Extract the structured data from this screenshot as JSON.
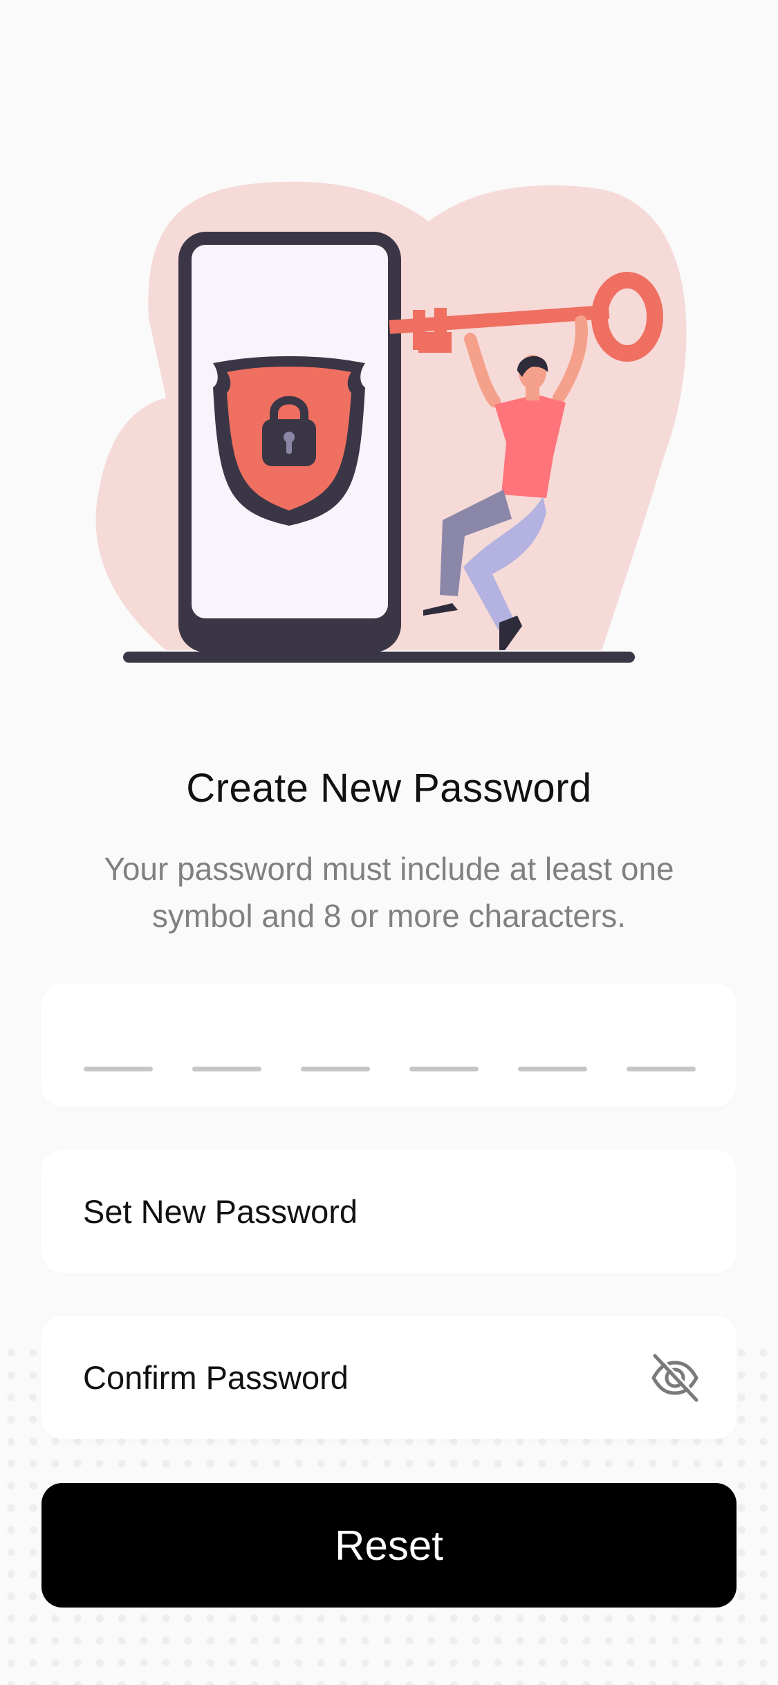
{
  "header": {
    "title": "Create New Password",
    "subtitle": "Your password must include at least one symbol and 8 or more characters."
  },
  "form": {
    "code_slots": 6,
    "new_password_placeholder": "Set New Password",
    "confirm_password_placeholder": "Confirm Password",
    "visibility_icon": "eye-slash-icon",
    "submit_label": "Reset"
  },
  "colors": {
    "accent": "#EF6F61",
    "dark": "#3A3646",
    "blob": "#F6DAD8",
    "button": "#000000"
  }
}
